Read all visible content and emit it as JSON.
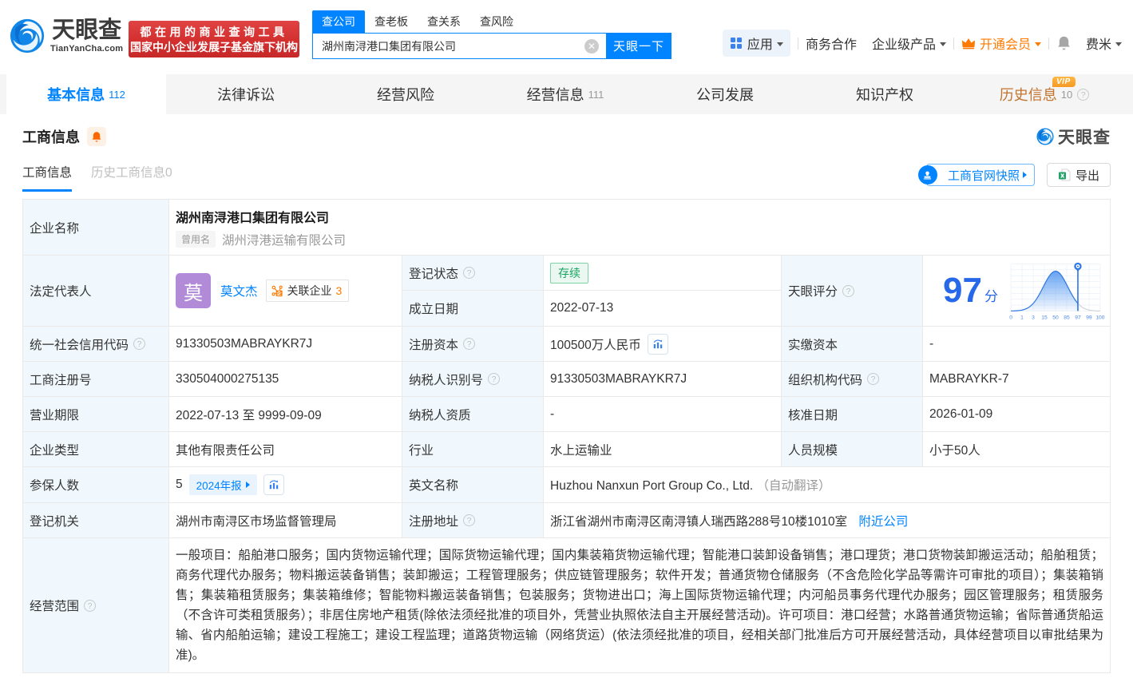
{
  "brand": {
    "name": "天眼查",
    "domain": "TianYanCha.com",
    "slogan_line1": "都在用的商业查询工具",
    "slogan_line2": "国家中小企业发展子基金旗下机构"
  },
  "search": {
    "tabs": [
      "查公司",
      "查老板",
      "查关系",
      "查风险"
    ],
    "active_tab": "查公司",
    "value": "湖州南浔港口集团有限公司",
    "button": "天眼一下"
  },
  "header_menu": {
    "apps": "应用",
    "cooperation": "商务合作",
    "enterprise": "企业级产品",
    "vip": "开通会员",
    "user": "费米"
  },
  "nav_tabs": [
    {
      "label": "基本信息",
      "count": "112"
    },
    {
      "label": "法律诉讼",
      "count": ""
    },
    {
      "label": "经营风险",
      "count": ""
    },
    {
      "label": "经营信息",
      "count": "111"
    },
    {
      "label": "公司发展",
      "count": ""
    },
    {
      "label": "知识产权",
      "count": ""
    },
    {
      "label": "历史信息",
      "count": "10",
      "vip": "VIP"
    }
  ],
  "section": {
    "title": "工商信息",
    "watermark": "天眼查",
    "subtab_active": "工商信息",
    "subtab_history": "历史工商信息0",
    "snapshot_button": "工商官网快照",
    "export_button": "导出"
  },
  "fields": {
    "name_label": "企业名称",
    "name": "湖州南浔港口集团有限公司",
    "former_badge": "曾用名",
    "former_name": "湖州浔港运输有限公司",
    "legal_label": "法定代表人",
    "avatar_char": "莫",
    "legal_name": "莫文杰",
    "related_label": "关联企业",
    "related_count": "3",
    "status_label": "登记状态",
    "status": "存续",
    "date_label": "成立日期",
    "date": "2022-07-13",
    "score_label": "天眼评分",
    "uscc_label": "统一社会信用代码",
    "uscc": "91330503MABRAYKR7J",
    "capital_label": "注册资本",
    "capital": "100500万人民币",
    "paid_label": "实缴资本",
    "paid": "-",
    "regno_label": "工商注册号",
    "regno": "330504000275135",
    "taxid_label": "纳税人识别号",
    "taxid": "91330503MABRAYKR7J",
    "orgcode_label": "组织机构代码",
    "orgcode": "MABRAYKR-7",
    "term_label": "营业期限",
    "term": "2022-07-13 至 9999-09-09",
    "taxq_label": "纳税人资质",
    "taxq": "-",
    "approve_label": "核准日期",
    "approve": "2026-01-09",
    "type_label": "企业类型",
    "type": "其他有限责任公司",
    "industry_label": "行业",
    "industry": "水上运输业",
    "staff_label": "人员规模",
    "staff": "小于50人",
    "insured_label": "参保人数",
    "insured": "5",
    "insured_report": "2024年报",
    "en_label": "英文名称",
    "en_name": "Huzhou Nanxun Port Group Co., Ltd.",
    "en_note": "（自动翻译）",
    "authority_label": "登记机关",
    "authority": "湖州市南浔区市场监督管理局",
    "address_label": "注册地址",
    "address": "浙江省湖州市南浔区南浔镇人瑞西路288号10楼1010室",
    "nearby_link": "附近公司",
    "scope_label": "经营范围",
    "scope": "一般项目：船舶港口服务；国内货物运输代理；国际货物运输代理；国内集装箱货物运输代理；智能港口装卸设备销售；港口理货；港口货物装卸搬运活动；船舶租赁；商务代理代办服务；物料搬运装备销售；装卸搬运；工程管理服务；供应链管理服务；软件开发；普通货物仓储服务（不含危险化学品等需许可审批的项目）；集装箱销售；集装箱租赁服务；集装箱维修；智能物料搬运装备销售；包装服务；货物进出口；海上国际货物运输代理；内河船员事务代理代办服务；园区管理服务；租赁服务（不含许可类租赁服务）；非居住房地产租赁(除依法须经批准的项目外，凭营业执照依法自主开展经营活动)。许可项目：港口经营；水路普通货物运输；省际普通货船运输、省内船舶运输；建设工程施工；建设工程监理；道路货物运输（网络货运）(依法须经批准的项目，经相关部门批准后方可开展经营活动，具体经营项目以审批结果为准)。"
  },
  "chart_data": {
    "type": "area",
    "title": "天眼评分",
    "score": "97",
    "score_unit": "分",
    "x_ticks": [
      "0",
      "1",
      "3",
      "15",
      "50",
      "85",
      "97",
      "99",
      "100"
    ],
    "marker_at": "97",
    "peak_at": "50"
  },
  "colors": {
    "primary": "#0084ff",
    "orange": "#ff7a00",
    "green": "#16a35f",
    "red_banner": "#d32f2f",
    "score_blue": "#2668e8",
    "label_bg": "#f0f8fd"
  }
}
